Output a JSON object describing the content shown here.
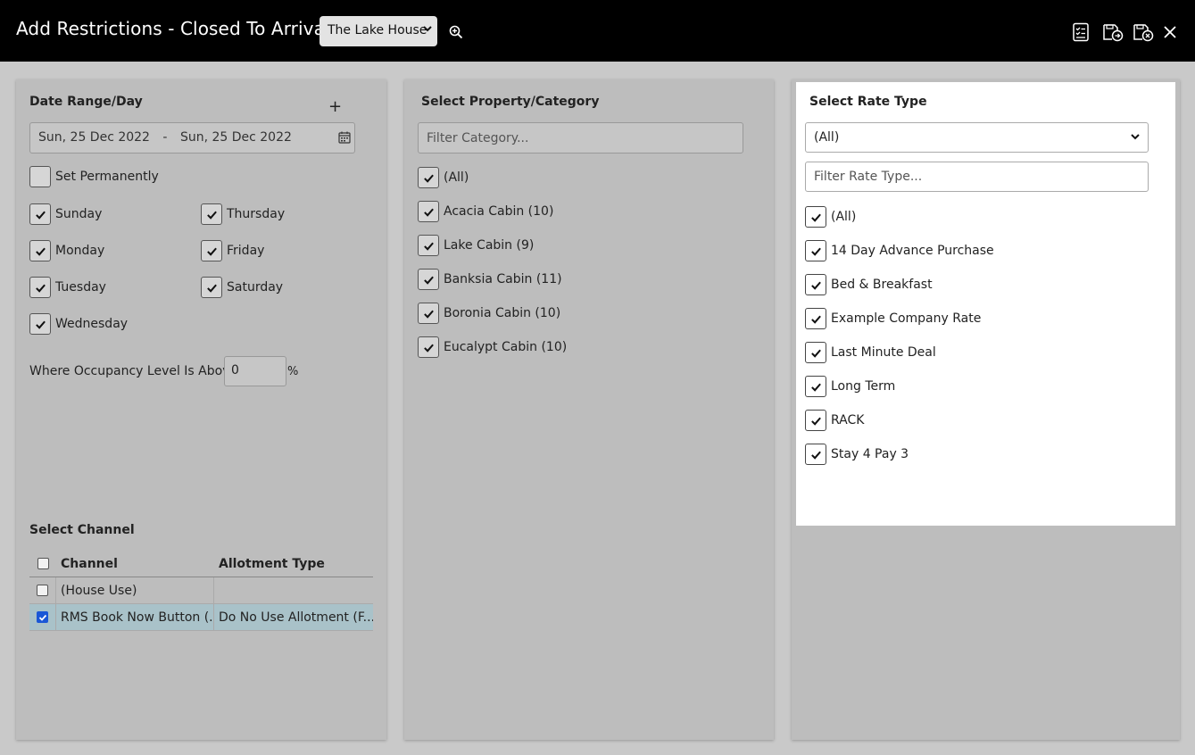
{
  "header": {
    "title": "Add Restrictions - Closed To Arrival",
    "property_selected": "The Lake House",
    "icons": [
      "zoom-in-icon",
      "checklist-icon",
      "save-next-icon",
      "save-close-icon",
      "close-icon"
    ]
  },
  "date_panel": {
    "title": "Date Range/Day",
    "add_label": "+",
    "date_from": "Sun, 25 Dec 2022",
    "date_separator": "-",
    "date_to": "Sun, 25 Dec 2022",
    "set_permanently": {
      "label": "Set Permanently",
      "checked": false
    },
    "days": [
      {
        "label": "Sunday",
        "checked": true
      },
      {
        "label": "Thursday",
        "checked": true
      },
      {
        "label": "Monday",
        "checked": true
      },
      {
        "label": "Friday",
        "checked": true
      },
      {
        "label": "Tuesday",
        "checked": true
      },
      {
        "label": "Saturday",
        "checked": true
      },
      {
        "label": "Wednesday",
        "checked": true
      }
    ],
    "occupancy_label": "Where Occupancy Level Is Above",
    "occupancy_value": "0",
    "occupancy_unit": "%"
  },
  "channel": {
    "title": "Select Channel",
    "columns": [
      "Channel",
      "Allotment Type"
    ],
    "rows": [
      {
        "channel": "(House Use)",
        "allotment": "",
        "checked": false
      },
      {
        "channel": "RMS Book Now Button (...",
        "allotment": "Do No Use Allotment (F...",
        "checked": true
      }
    ]
  },
  "category_panel": {
    "title": "Select Property/Category",
    "filter_placeholder": "Filter Category...",
    "items": [
      {
        "label": "(All)",
        "checked": true
      },
      {
        "label": "Acacia Cabin (10)",
        "checked": true
      },
      {
        "label": "Lake Cabin (9)",
        "checked": true
      },
      {
        "label": "Banksia Cabin (11)",
        "checked": true
      },
      {
        "label": "Boronia Cabin (10)",
        "checked": true
      },
      {
        "label": "Eucalypt Cabin (10)",
        "checked": true
      }
    ]
  },
  "rate_panel": {
    "title": "Select Rate Type",
    "select_value": "(All)",
    "filter_placeholder": "Filter Rate Type...",
    "items": [
      {
        "label": "(All)",
        "checked": true
      },
      {
        "label": "14 Day Advance Purchase",
        "checked": true
      },
      {
        "label": "Bed & Breakfast",
        "checked": true
      },
      {
        "label": "Example Company Rate",
        "checked": true
      },
      {
        "label": "Last Minute Deal",
        "checked": true
      },
      {
        "label": "Long Term",
        "checked": true
      },
      {
        "label": "RACK",
        "checked": true
      },
      {
        "label": "Stay 4 Pay 3",
        "checked": true
      }
    ]
  }
}
